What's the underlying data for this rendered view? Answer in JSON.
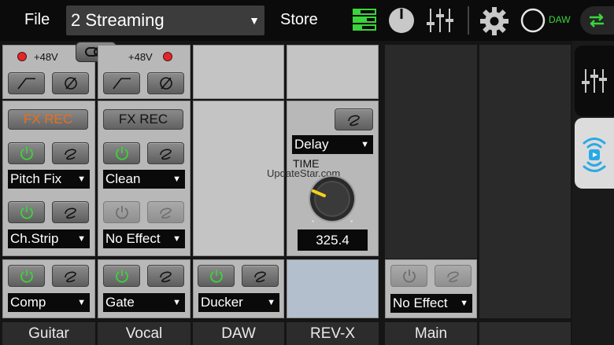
{
  "topbar": {
    "file_label": "File",
    "preset_label": "2  Streaming",
    "store_label": "Store",
    "daw_label": "DAW"
  },
  "colors": {
    "accent_green": "#3bd43b",
    "orange_text": "#e8701a",
    "blue_accent": "#29a9e6",
    "led_red": "#e2262a"
  },
  "channels": [
    {
      "name": "Guitar",
      "phantom_label": "+48V",
      "fx_rec_label": "FX REC",
      "fx_rec_active": true,
      "fx1": "Pitch Fix",
      "fx2": "Ch.Strip",
      "dyn": "Comp"
    },
    {
      "name": "Vocal",
      "phantom_label": "+48V",
      "fx_rec_label": "FX REC",
      "fx_rec_active": false,
      "fx1": "Clean",
      "fx2": "No Effect",
      "dyn": "Gate"
    },
    {
      "name": "DAW",
      "dyn": "Ducker"
    },
    {
      "name": "REV-X",
      "reverb_type": "Delay",
      "time_label": "TIME",
      "time_value": "325.4"
    },
    {
      "name": "Main",
      "dyn": "No Effect"
    }
  ],
  "watermark": "UpdateStar.com",
  "icons": {
    "topbar": [
      "mixer-view-icon",
      "meter-dial-icon",
      "faders-icon",
      "gear-icon",
      "daw-toggle-icon",
      "sync-arrows-icon"
    ],
    "rail": [
      "faders-icon",
      "stream-broadcast-icon"
    ]
  }
}
